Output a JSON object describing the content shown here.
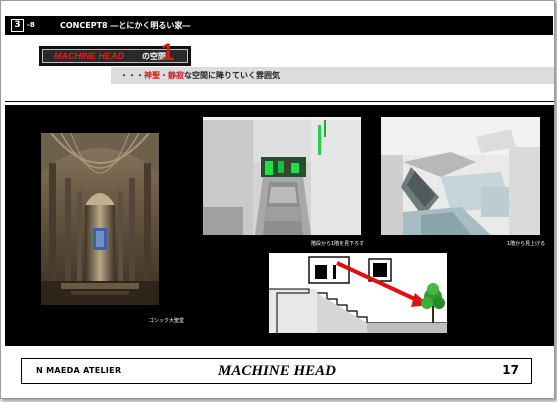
{
  "header": {
    "section_number": "3",
    "section_sub": "-8",
    "concept_line": "CONCEPT8 ―とにかく明るい家―"
  },
  "title": {
    "name_red": "MACHINE HEAD",
    "name_suffix": "の空間",
    "number": "1"
  },
  "subtitle": {
    "prefix": "・・・",
    "red_part": "神聖・静寂",
    "rest": "な空間に降りていく雰囲気"
  },
  "images": {
    "cathedral_caption": "ゴシック大聖堂",
    "view_down_caption": "階段から1階を見下ろす",
    "view_up_caption": "1階から見上げる"
  },
  "footer": {
    "atelier": "N MAEDA  ATELIER",
    "project_title": "MACHINE HEAD",
    "page_number": "17"
  }
}
